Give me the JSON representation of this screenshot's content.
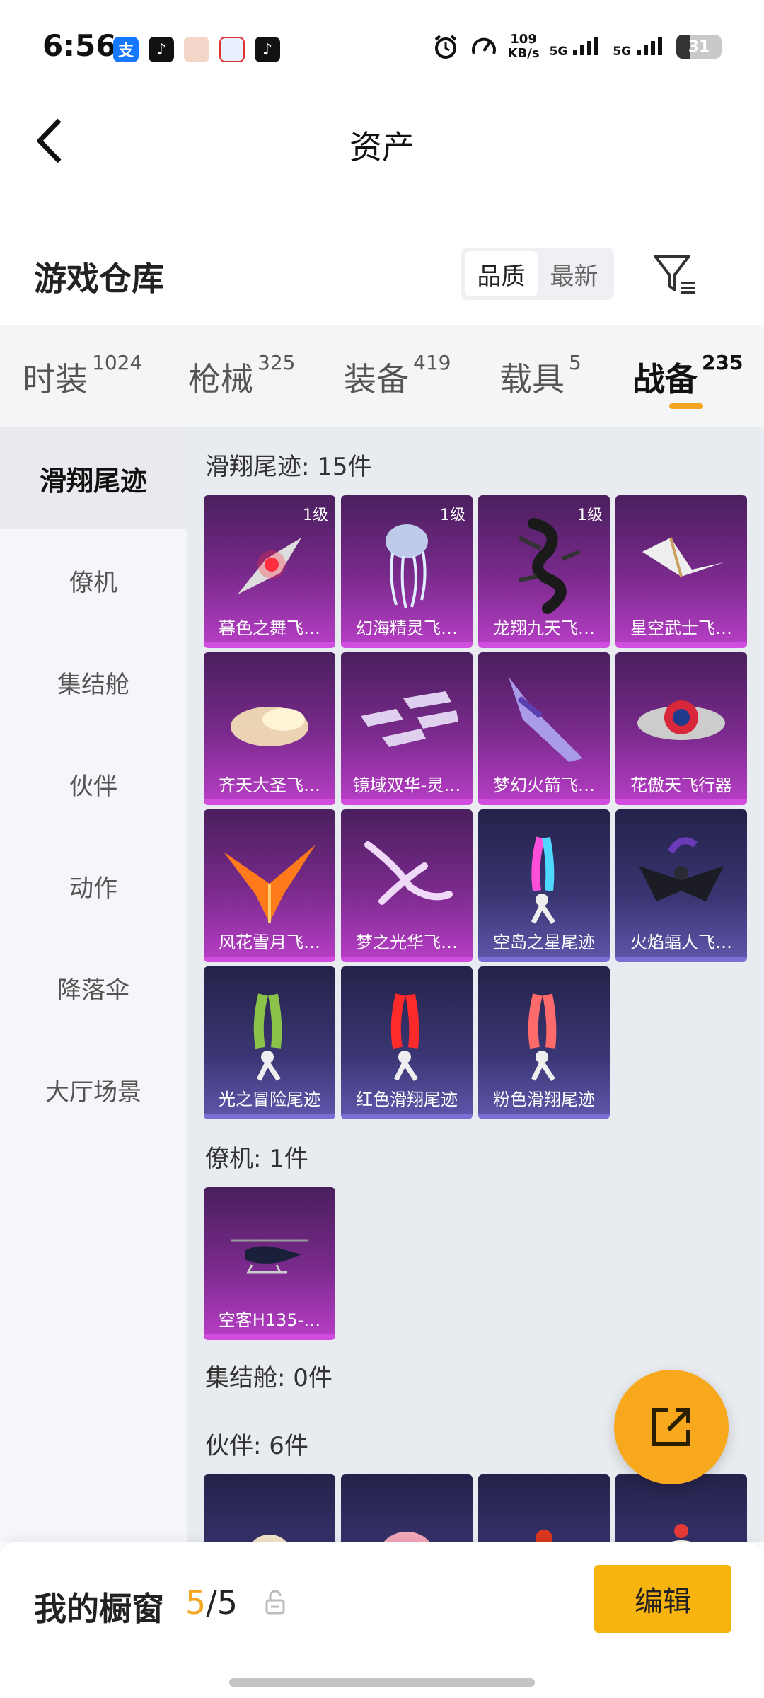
{
  "status": {
    "time": "6:56",
    "speed_value": "109",
    "speed_unit": "KB/s",
    "net1": "5G",
    "net2": "5G",
    "battery": "31",
    "app_icons": [
      "alipay-icon",
      "tiktok-icon",
      "avatar-app-icon",
      "mail-app-icon",
      "tiktok-icon"
    ]
  },
  "header": {
    "title": "资产"
  },
  "warehouse": {
    "title": "游戏仓库",
    "sort_options": [
      "品质",
      "最新"
    ],
    "active_sort": "品质"
  },
  "tabs": [
    {
      "label": "时装",
      "count": "1024"
    },
    {
      "label": "枪械",
      "count": "325"
    },
    {
      "label": "装备",
      "count": "419"
    },
    {
      "label": "载具",
      "count": "5"
    },
    {
      "label": "战备",
      "count": "235"
    }
  ],
  "active_tab": "战备",
  "sidenav": [
    "滑翔尾迹",
    "僚机",
    "集结舱",
    "伙伴",
    "动作",
    "降落伞",
    "大厅场景"
  ],
  "active_nav": "滑翔尾迹",
  "sections": [
    {
      "title": "滑翔尾迹: 15件",
      "items": [
        {
          "name": "暮色之舞飞…",
          "level": "1级",
          "style": "purple",
          "art": "wing-red"
        },
        {
          "name": "幻海精灵飞…",
          "level": "1级",
          "style": "purple",
          "art": "jellyfish"
        },
        {
          "name": "龙翔九天飞…",
          "level": "1级",
          "style": "purple",
          "art": "dragon"
        },
        {
          "name": "星空武士飞…",
          "level": "",
          "style": "purple",
          "art": "glider-white"
        },
        {
          "name": "齐天大圣飞…",
          "level": "",
          "style": "purple",
          "art": "cloud"
        },
        {
          "name": "镜域双华-灵…",
          "level": "",
          "style": "purple",
          "art": "crystals"
        },
        {
          "name": "梦幻火箭飞…",
          "level": "",
          "style": "purple",
          "art": "rocket"
        },
        {
          "name": "花傲天飞行器",
          "level": "",
          "style": "purple",
          "art": "saucer"
        },
        {
          "name": "风花雪月飞…",
          "level": "",
          "style": "purple",
          "art": "phoenix"
        },
        {
          "name": "梦之光华飞…",
          "level": "",
          "style": "purple",
          "art": "petals"
        },
        {
          "name": "空岛之星尾迹",
          "level": "",
          "style": "blue",
          "art": "trail-rainbow"
        },
        {
          "name": "火焰蝠人飞…",
          "level": "",
          "style": "blue",
          "art": "batman"
        },
        {
          "name": "光之冒险尾迹",
          "level": "",
          "style": "blue",
          "art": "trail-green"
        },
        {
          "name": "红色滑翔尾迹",
          "level": "",
          "style": "blue",
          "art": "trail-red"
        },
        {
          "name": "粉色滑翔尾迹",
          "level": "",
          "style": "blue",
          "art": "trail-pink"
        }
      ]
    },
    {
      "title": "僚机: 1件",
      "items": [
        {
          "name": "空客H135-…",
          "level": "",
          "style": "purple",
          "art": "helicopter"
        }
      ]
    },
    {
      "title": "集结舱: 0件",
      "items": []
    },
    {
      "title": "伙伴: 6件",
      "items": [
        {
          "name": "",
          "level": "",
          "style": "blue",
          "art": "partner-1"
        },
        {
          "name": "",
          "level": "",
          "style": "blue",
          "art": "partner-2"
        },
        {
          "name": "",
          "level": "",
          "style": "blue",
          "art": "partner-3"
        },
        {
          "name": "",
          "level": "",
          "style": "blue",
          "art": "partner-4"
        }
      ]
    }
  ],
  "bottom": {
    "showcase_label": "我的橱窗",
    "showcase_current": "5",
    "showcase_sep": "/",
    "showcase_total": "5",
    "edit_label": "编辑"
  },
  "colors": {
    "accent": "#f5a623",
    "edit_button": "#f8b40e",
    "purple_card": "#b43dc3",
    "blue_card": "#5c55a8"
  }
}
